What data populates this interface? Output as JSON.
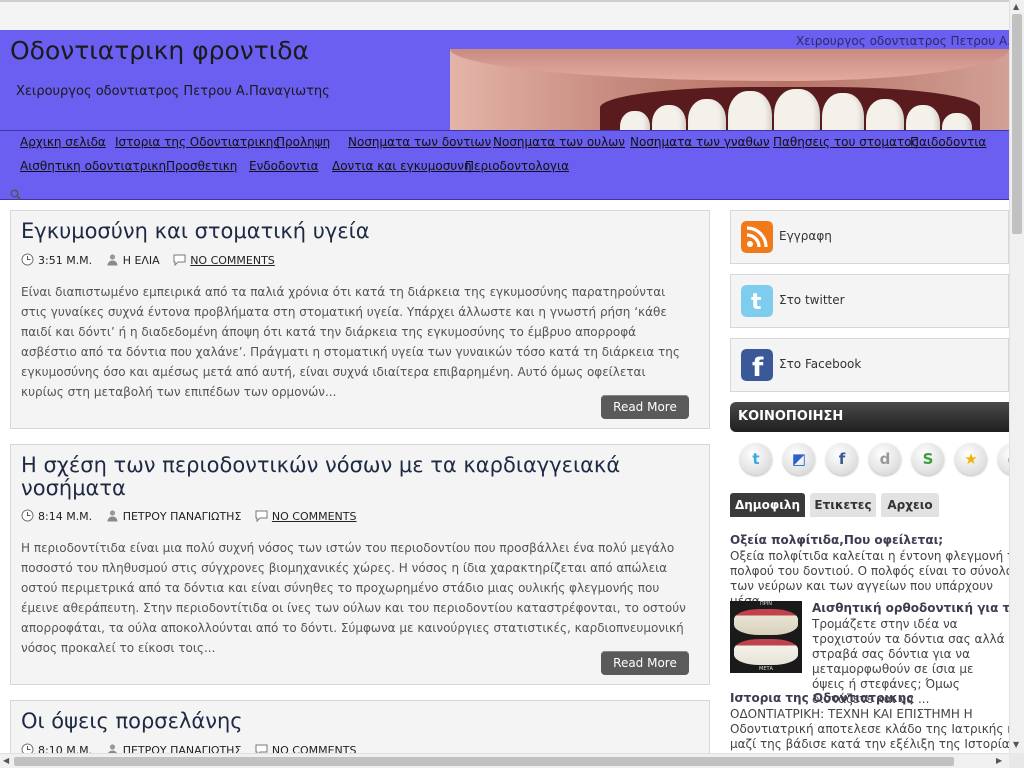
{
  "header": {
    "site_title": "Οδοντιατρικη φροντιδα",
    "subtitle": "Χειρουργος οδοντιατρος Πετρου Α.Παναγιωτης",
    "ticker": "Χειρουργος οδοντιατρος Πετρου Α.Παναγιωτης"
  },
  "nav": {
    "items": [
      {
        "label": "Αρχικη σελιδα"
      },
      {
        "label": "Ιστορια της Οδοντιατρικης"
      },
      {
        "label": "Προληψη"
      },
      {
        "label": "Νοσηματα των δοντιων"
      },
      {
        "label": "Νοσηματα των ουλων"
      },
      {
        "label": "Νοσηματα των γναθων"
      },
      {
        "label": "Παθησεις του στοματος"
      },
      {
        "label": "Παιδοδοντια"
      },
      {
        "label": "Αισθητικη οδοντιατρικη"
      },
      {
        "label": "Προσθετικη"
      },
      {
        "label": "Ενδοδοντια"
      },
      {
        "label": "Δοντια και εγκυμοσυνη"
      },
      {
        "label": "Περιοδοντολογια"
      }
    ],
    "search_icon": "search-icon"
  },
  "posts": [
    {
      "title": "Εγκυμοσύνη και στοματική υγεία",
      "time": "3:51 Μ.Μ.",
      "author": "Η ΕΛΙΑ",
      "comments": "NO COMMENTS",
      "excerpt": "Είναι διαπιστωμένο εμπειρικά από τα παλιά χρόνια ότι κατά τη διάρκεια της εγκυμοσύνης παρατηρούνται στις γυναίκες συχνά έντονα προβλήματα στη στοματική υγεία. Υπάρχει άλλωστε και η γνωστή ρήση ‘κάθε παιδί και δόντι’ ή η διαδεδομένη άποψη ότι κατά την διάρκεια της εγκυμοσύνης το έμβρυο απορροφά ασβέστιο από τα δόντια που χαλάνε’. Πράγματι η στοματική υγεία των γυναικών τόσο κατά τη διάρκεια της εγκυμοσύνης όσο και αμέσως μετά από αυτή, είναι συχνά ιδιαίτερα επιβαρημένη. Αυτό όμως οφείλεται κυρίως στη μεταβολή των επιπέδων των ορμονών...",
      "read_more": "Read More"
    },
    {
      "title": "Η σχέση των περιοδοντικών νόσων με τα καρδιαγγειακά νοσήματα",
      "time": "8:14 Μ.Μ.",
      "author": "ΠΕΤΡΟΥ ΠΑΝΑΓΙΩΤΗΣ",
      "comments": "NO COMMENTS",
      "excerpt": "Η περιοδοντίτιδα είναι μια πολύ συχνή νόσος των ιστών του περιοδοντίου που προσβάλλει ένα πολύ μεγάλο ποσοστό του πληθυσμού στις σύγχρονες βιομηχανικές χώρες. Η νόσος η ίδια χαρακτηρίζεται από απώλεια οστού περιμετρικά από τα δόντια και είναι σύνηθες το προχωρημένο στάδιο μιας ουλικής φλεγμονής που έμεινε αθεράπευτη. Στην περιοδοντίτιδα οι ίνες των ούλων και του περιοδοντίου καταστρέφονται, το οστούν απορροφάται, τα ούλα αποκολλούνται από το δόντι. Σύμφωνα με καινούργιες στατιστικές, καρδιοπνευμονική νόσος προκαλεί το είκοσι τοις...",
      "read_more": "Read More"
    },
    {
      "title": "Οι όψεις πορσελάνης",
      "time": "8:10 Μ.Μ.",
      "author": "ΠΕΤΡΟΥ ΠΑΝΑΓΙΩΤΗΣ",
      "comments": "NO COMMENTS"
    }
  ],
  "sidebar": {
    "social": [
      {
        "label": "Εγγραφη",
        "icon": "rss-icon",
        "color": "#f07a1a"
      },
      {
        "label": "Στο twitter",
        "icon": "twitter-icon",
        "color": "#7fcdee"
      },
      {
        "label": "Στο Facebook",
        "icon": "facebook-icon",
        "color": "#3b5998"
      }
    ],
    "share_title": "ΚΟΙΝΟΠΟΙΗΣΗ",
    "share_buttons": [
      {
        "icon": "twitter-share-icon",
        "glyph": "t",
        "color": "#39a9e0"
      },
      {
        "icon": "delicious-share-icon",
        "glyph": "◩",
        "color": "#2a63c6"
      },
      {
        "icon": "facebook-share-icon",
        "glyph": "f",
        "color": "#3b5998"
      },
      {
        "icon": "digg-share-icon",
        "glyph": "d",
        "color": "#999999"
      },
      {
        "icon": "stumbleupon-share-icon",
        "glyph": "S",
        "color": "#3a9e3a"
      },
      {
        "icon": "favorite-share-icon",
        "glyph": "★",
        "color": "#f0b400"
      },
      {
        "icon": "share-more-icon",
        "glyph": "●",
        "color": "#2bb02b"
      }
    ],
    "tabs": [
      {
        "label": "Δημοφιλη"
      },
      {
        "label": "Ετικετες"
      },
      {
        "label": "Αρχειο"
      }
    ],
    "popular": [
      {
        "title": "Οξεία πολφίτιδα,Που οφείλεται;",
        "text": "Οξεία πολφίτιδα καλείται η έντονη φλεγμονή του πολφού του δοντιού. Ο πολφός είναι το σύνολο των νεύρων και των αγγείων που υπάρχουν μέσα..."
      },
      {
        "title": "Αισθητική ορθοδοντική για τους ενήλικες",
        "text": "Τρομάζετε στην ιδέα να τροχιστούν τα δόντια σας αλλά στραβά σας δόντια για να μεταμορφωθούν σε ίσια με όψεις ή στεφάνες; Όμως διστάζετε και να ...",
        "thumb_top": "ΠΡΙΝ",
        "thumb_bottom": "ΜΕΤΑ"
      },
      {
        "title": "Ιστορια της Οδοντιατρικης",
        "text": "ΟΔΟΝΤΙΑΤΡΙΚΗ: ΤΕΧΝΗ ΚΑΙ ΕΠΙΣΤΗΜΗ Η Οδοντιατρική αποτελεσε κλάδο της Ιατρικής και μαζί της βάδισε κατά την εξέλιξη της Ιστορίας του ανθρ..."
      }
    ]
  }
}
